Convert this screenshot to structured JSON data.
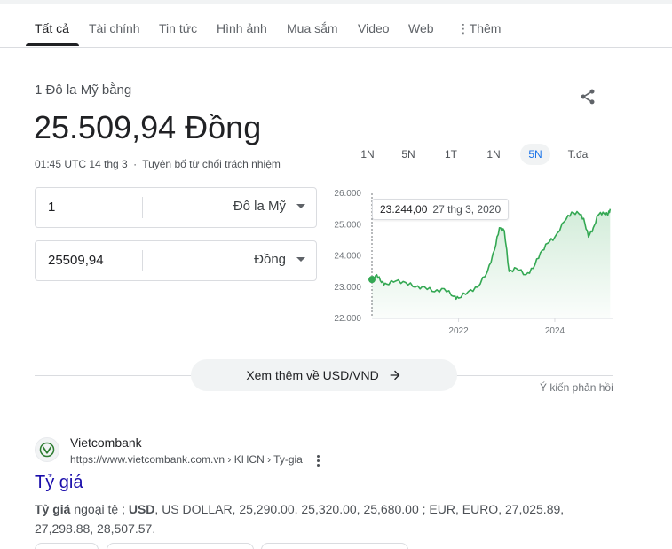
{
  "tabs": [
    {
      "label": "Tất cả",
      "active": true
    },
    {
      "label": "Tài chính"
    },
    {
      "label": "Tin tức"
    },
    {
      "label": "Hình ảnh"
    },
    {
      "label": "Mua sắm"
    },
    {
      "label": "Video"
    },
    {
      "label": "Web"
    },
    {
      "label": "Thêm"
    }
  ],
  "converter": {
    "label": "1 Đô la Mỹ bằng",
    "value": "25.509,94 Đồng",
    "timestamp": "01:45 UTC 14 thg 3",
    "separator": "·",
    "disclaimer": "Tuyên bố từ chối trách nhiệm",
    "from_amount": "1",
    "from_currency": "Đô la Mỹ",
    "to_amount": "25509,94",
    "to_currency": "Đồng"
  },
  "ranges": [
    {
      "label": "1N"
    },
    {
      "label": "5N"
    },
    {
      "label": "1T"
    },
    {
      "label": "1N"
    },
    {
      "label": "5N",
      "active": true
    },
    {
      "label": "T.đa"
    }
  ],
  "tooltip": {
    "value": "23.244,00",
    "date": "27 thg 3, 2020"
  },
  "chart_data": {
    "type": "area",
    "y_tick_labels": [
      "26.000",
      "25.000",
      "24.000",
      "23.000",
      "22.000"
    ],
    "x_tick_labels": [
      "2022",
      "2024"
    ],
    "ylim": [
      22000,
      26000
    ],
    "xlim": [
      2020.2,
      2025.2
    ],
    "grid": false,
    "line_color": "#34a853",
    "series": [
      {
        "x": [
          2020.2,
          2020.3,
          2020.4,
          2020.5,
          2020.7,
          2020.9,
          2021.1,
          2021.3,
          2021.5,
          2021.7,
          2021.9,
          2022.0,
          2022.2,
          2022.4,
          2022.6,
          2022.75,
          2022.85,
          2022.95,
          2023.05,
          2023.2,
          2023.4,
          2023.55,
          2023.7,
          2023.85,
          2024.0,
          2024.2,
          2024.35,
          2024.5,
          2024.6,
          2024.7,
          2024.8,
          2024.9,
          2025.0,
          2025.1,
          2025.15
        ],
        "y": [
          23244,
          23400,
          23150,
          23100,
          23200,
          23150,
          23000,
          23000,
          22850,
          22950,
          22700,
          22650,
          22850,
          23000,
          23500,
          24200,
          24900,
          24800,
          23500,
          23600,
          23400,
          23600,
          24100,
          24400,
          24600,
          25100,
          25400,
          25350,
          25200,
          24600,
          24900,
          25300,
          25400,
          25300,
          25500
        ]
      }
    ]
  },
  "more_button": {
    "label": "Xem thêm về USD/VND"
  },
  "feedback": "Ý kiến phản hồi",
  "result": {
    "site_name": "Vietcombank",
    "url": "https://www.vietcombank.com.vn › KHCN › Ty-gia",
    "title": "Tỷ giá",
    "snippet_b1": "Tỷ giá",
    "snippet_t1": " ngoại tệ ; ",
    "snippet_b2": "USD",
    "snippet_t2": ", US DOLLAR, 25,290.00, 25,320.00, 25,680.00 ; EUR, EURO, 27,025.89, 27,298.88, 28,507.57."
  },
  "colors": {
    "accent": "#1a73e8",
    "link": "#1a0dab",
    "chart_line": "#34a853",
    "favicon": "#2e7d32"
  },
  "icons": {
    "share": "share-icon",
    "more": "more-vert-icon",
    "arrow": "arrow-right-icon",
    "favicon": "vietcombank-logo-icon"
  }
}
